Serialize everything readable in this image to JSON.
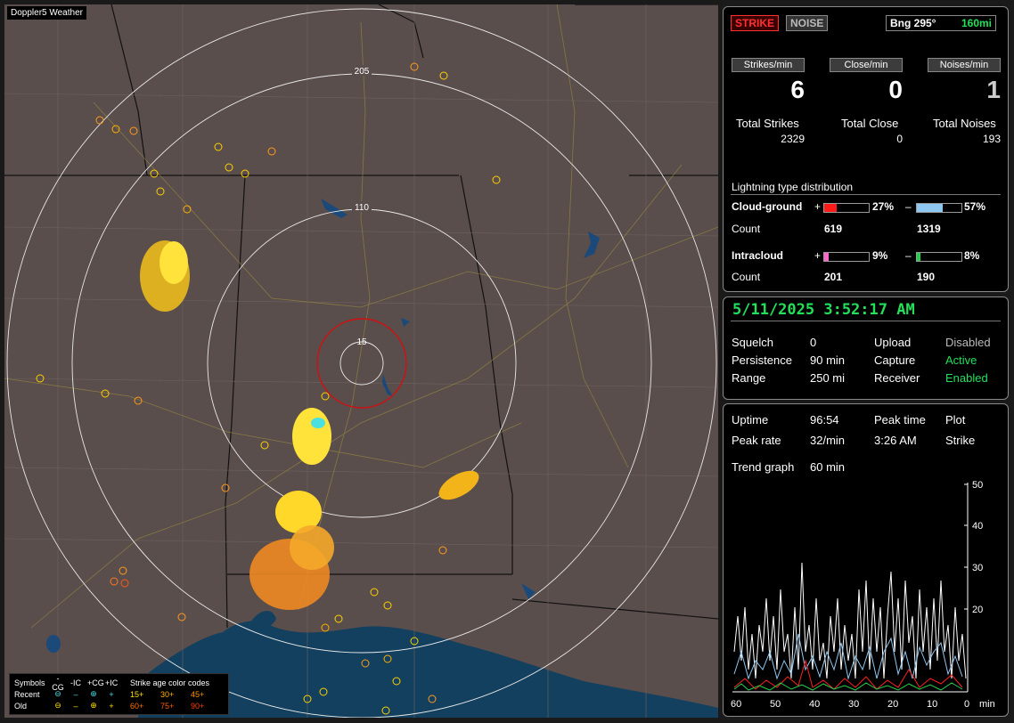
{
  "map": {
    "title": "Doppler5 Weather",
    "ring_labels": [
      "205",
      "110",
      "15"
    ]
  },
  "legend": {
    "symbols_label": "Symbols",
    "col_neg_cg": "-CG",
    "col_neg_ic": "-IC",
    "col_pos_cg": "+CG",
    "col_pos_ic": "+IC",
    "age_label": "Strike age color codes",
    "recent_label": "Recent",
    "old_label": "Old",
    "recent_ages": [
      "15+",
      "30+",
      "45+"
    ],
    "old_ages": [
      "60+",
      "75+",
      "90+"
    ],
    "age_colors": [
      "#ffe000",
      "#ffb000",
      "#ff8c00",
      "#ff7000",
      "#ff5a00",
      "#ff3c00"
    ]
  },
  "top": {
    "strike_btn": "STRIKE",
    "noise_btn": "NOISE",
    "bearing": "Bng 295°",
    "distance": "160mi",
    "strikes_min_label": "Strikes/min",
    "close_min_label": "Close/min",
    "noises_min_label": "Noises/min",
    "strikes_min": "6",
    "close_min": "0",
    "noises_min": "1",
    "total_strikes_label": "Total Strikes",
    "total_close_label": "Total Close",
    "total_noises_label": "Total Noises",
    "total_strikes": "2329",
    "total_close": "0",
    "total_noises": "193",
    "dist_title": "Lightning type distribution",
    "cg_label": "Cloud-ground",
    "ic_label": "Intracloud",
    "count_label": "Count",
    "plus": "+",
    "minus": "–",
    "cg_pos_pct": "27%",
    "cg_neg_pct": "57%",
    "ic_pos_pct": "9%",
    "ic_neg_pct": "8%",
    "cg_pos_count": "619",
    "cg_neg_count": "1319",
    "ic_pos_count": "201",
    "ic_neg_count": "190",
    "cg_pos_frac": 0.27,
    "cg_neg_frac": 0.57,
    "ic_pos_frac": 0.09,
    "ic_neg_frac": 0.08
  },
  "status": {
    "datetime": "5/11/2025 3:52:17 AM",
    "squelch_label": "Squelch",
    "squelch": "0",
    "persistence_label": "Persistence",
    "persistence": "90 min",
    "range_label": "Range",
    "range": "250 mi",
    "upload_label": "Upload",
    "upload": "Disabled",
    "capture_label": "Capture",
    "capture": "Active",
    "receiver_label": "Receiver",
    "receiver": "Enabled"
  },
  "trend": {
    "uptime_label": "Uptime",
    "uptime": "96:54",
    "peak_time_label": "Peak time",
    "peak_time": "3:26 AM",
    "plot_label": "Plot",
    "plot": "Strike",
    "peak_rate_label": "Peak rate",
    "peak_rate": "32/min",
    "trend_label": "Trend graph",
    "trend": "60 min",
    "y_ticks": [
      "50",
      "40",
      "30",
      "20"
    ],
    "x_ticks": [
      "60",
      "50",
      "40",
      "30",
      "20",
      "10",
      "0"
    ],
    "x_unit": "min"
  },
  "colors": {
    "strike_red": "#ff3030",
    "green": "#22e05a",
    "cg_pos": "#ff1a1a",
    "cg_neg": "#8ec8f2",
    "ic_pos": "#ff66cc",
    "ic_neg": "#22d04a"
  }
}
